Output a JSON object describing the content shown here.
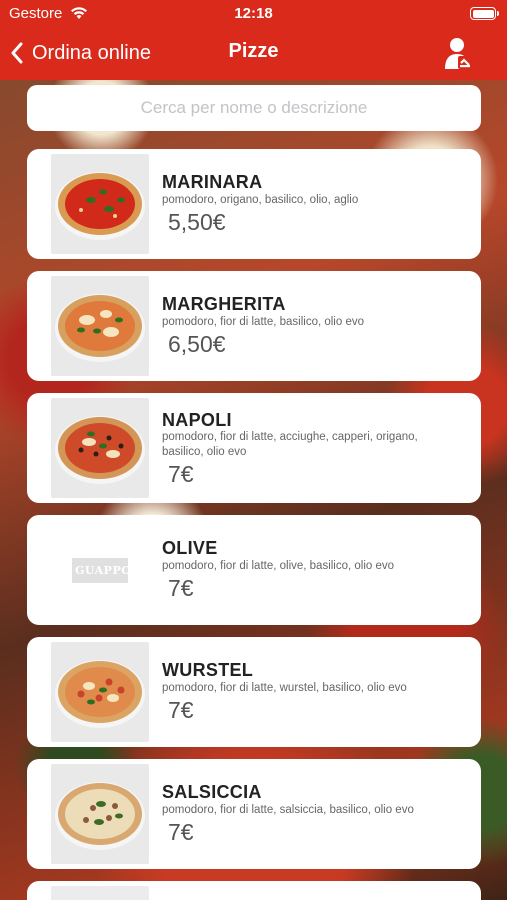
{
  "status_bar": {
    "carrier": "Gestore",
    "time": "12:18"
  },
  "nav": {
    "back_label": "Ordina online",
    "title": "Pizze",
    "back_icon": "chevron-left-icon",
    "user_icon": "user-account-icon"
  },
  "search": {
    "placeholder": "Cerca per nome o descrizione",
    "value": ""
  },
  "colors": {
    "accent": "#d92a1c"
  },
  "items": [
    {
      "name": "MARINARA",
      "description": "pomodoro, origano, basilico, olio, aglio",
      "price": "5,50€",
      "image": "pizza-marinara"
    },
    {
      "name": "MARGHERITA",
      "description": "pomodoro, fior di latte, basilico, olio evo",
      "price": "6,50€",
      "image": "pizza-margherita"
    },
    {
      "name": "NAPOLI",
      "description": "pomodoro, fior di latte, acciughe, capperi, origano, basilico, olio evo",
      "price": "7€",
      "image": "pizza-napoli"
    },
    {
      "name": "OLIVE",
      "description": "pomodoro, fior di latte, olive, basilico, olio evo",
      "price": "7€",
      "image": "logo",
      "logo_text": "GUAPPO"
    },
    {
      "name": "WURSTEL",
      "description": "pomodoro, fior di latte, wurstel, basilico, olio evo",
      "price": "7€",
      "image": "pizza-wurstel"
    },
    {
      "name": "SALSICCIA",
      "description": "pomodoro, fior di latte, salsiccia, basilico, olio evo",
      "price": "7€",
      "image": "pizza-salsiccia"
    }
  ]
}
